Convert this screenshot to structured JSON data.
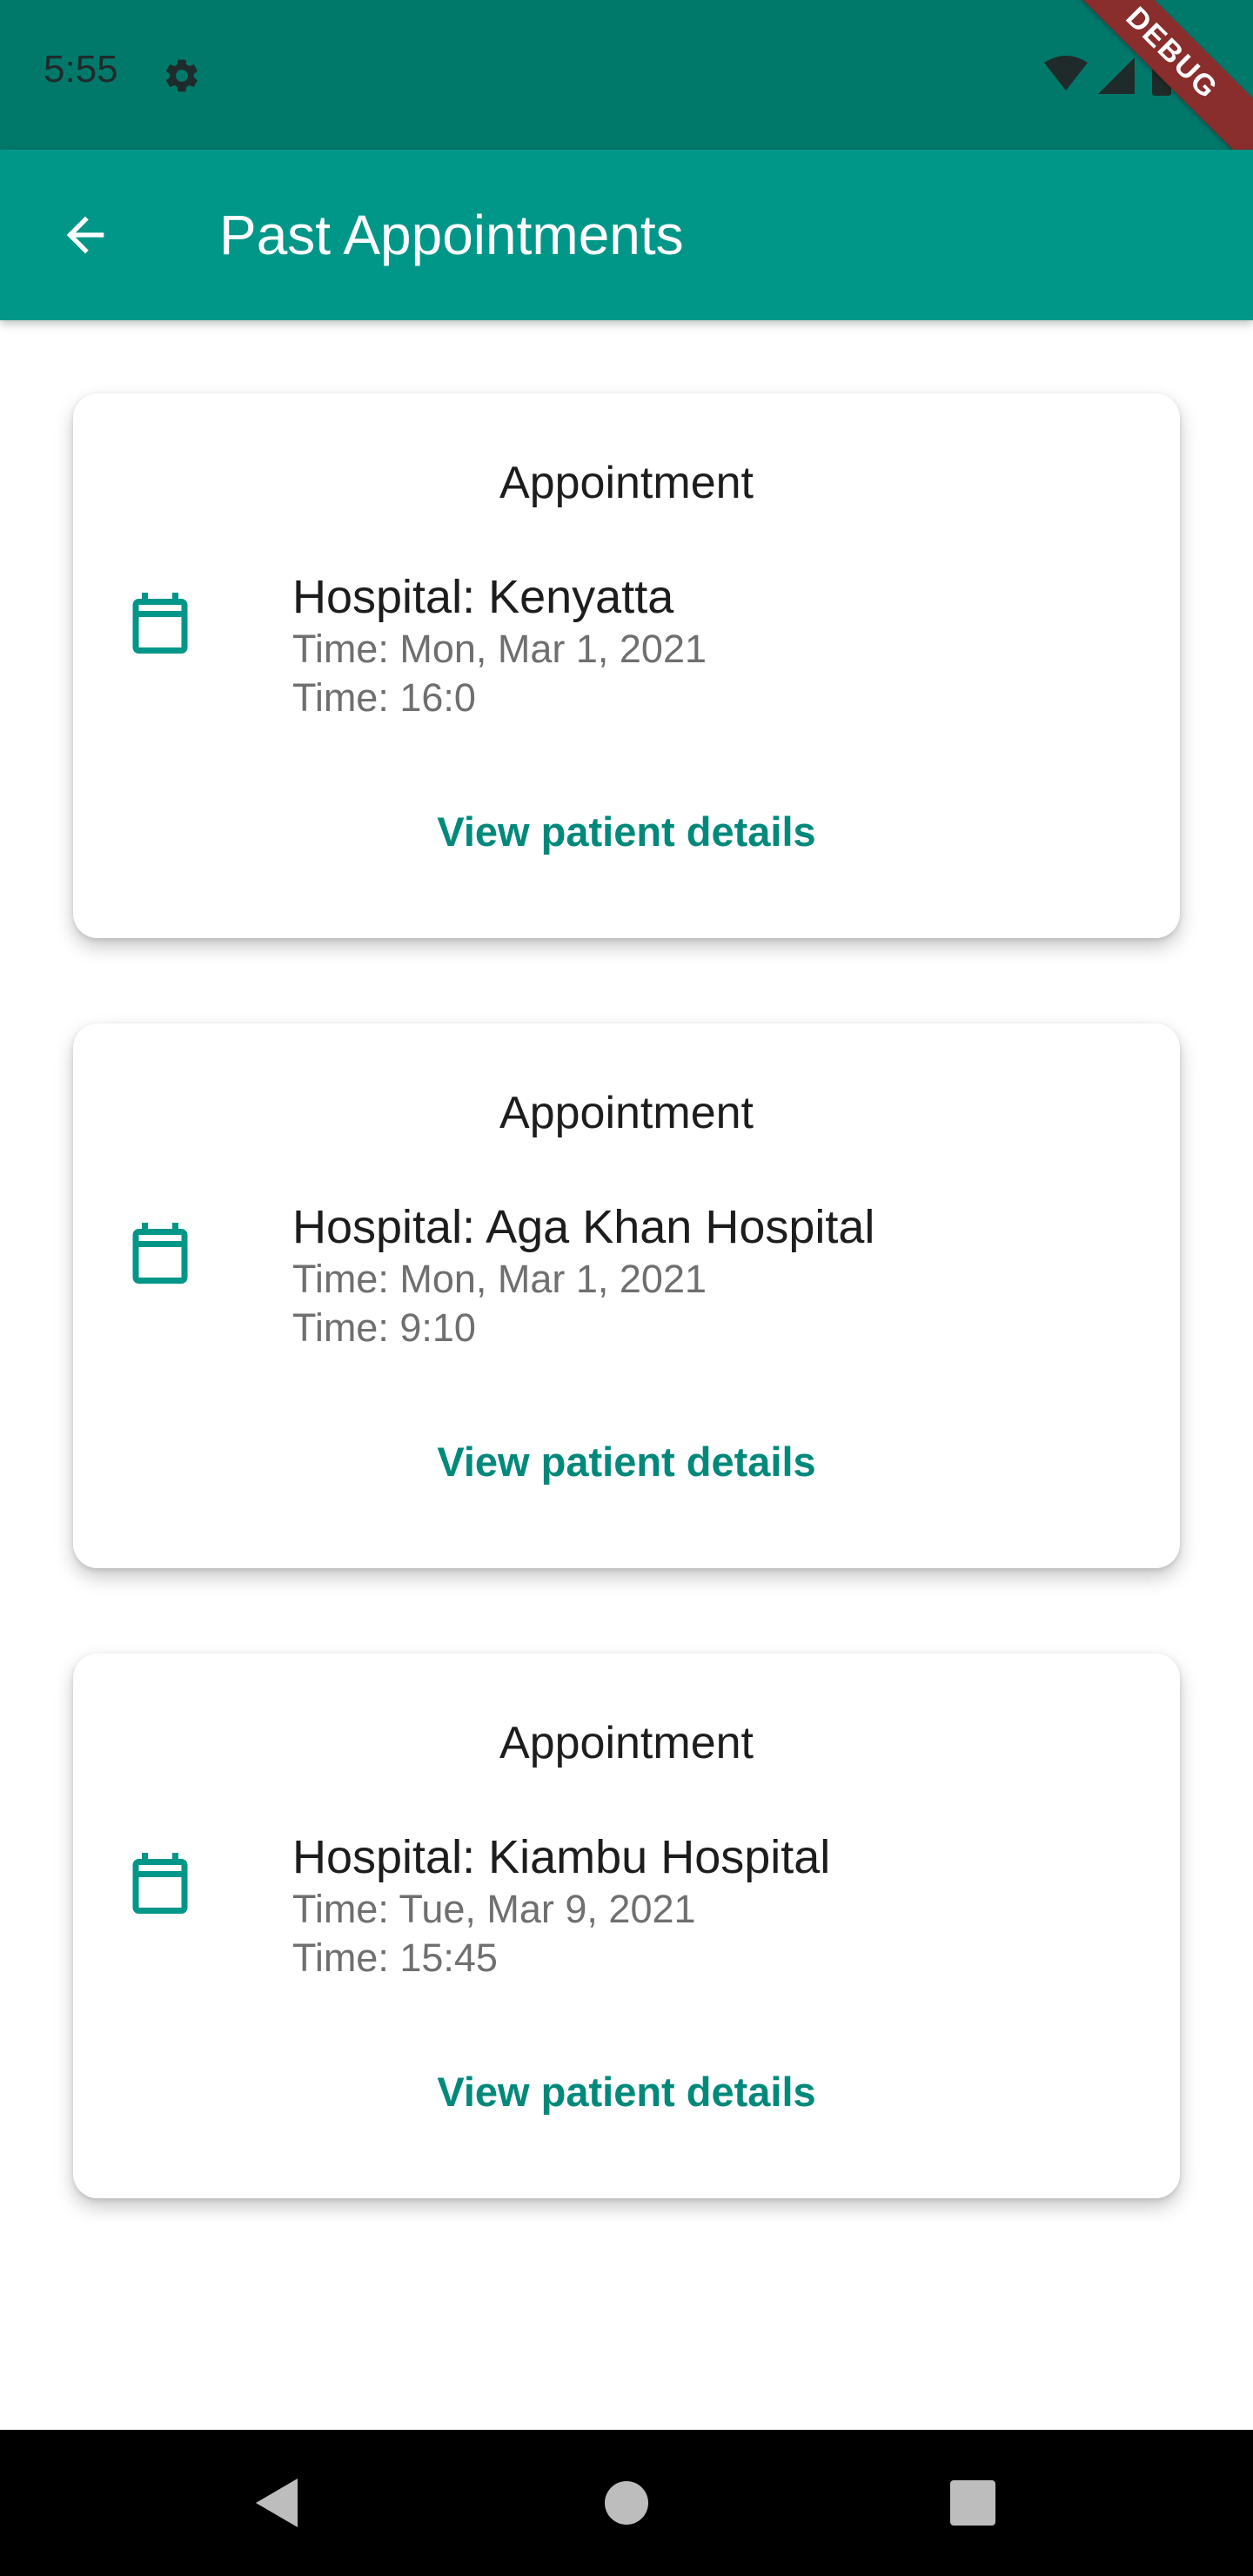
{
  "status_bar": {
    "time": "5:55",
    "debug_label": "DEBUG",
    "icons": [
      "gear-icon",
      "wifi-icon",
      "cell-signal-icon",
      "battery-icon"
    ]
  },
  "app_bar": {
    "title": "Past Appointments",
    "back_icon": "arrow-back-icon"
  },
  "colors": {
    "status_bar": "#00796b",
    "app_bar": "#009688",
    "accent": "#00897b",
    "card_background": "#ffffff",
    "nav_bar": "#000000"
  },
  "appointments": [
    {
      "title": "Appointment",
      "hospital": "Hospital: Kenyatta",
      "date": "Time: Mon, Mar 1, 2021",
      "time": "Time: 16:0",
      "action": "View patient details",
      "icon": "calendar-icon"
    },
    {
      "title": "Appointment",
      "hospital": "Hospital: Aga Khan Hospital",
      "date": "Time: Mon, Mar 1, 2021",
      "time": "Time: 9:10",
      "action": "View patient details",
      "icon": "calendar-icon"
    },
    {
      "title": "Appointment",
      "hospital": "Hospital: Kiambu Hospital",
      "date": "Time: Tue, Mar 9, 2021",
      "time": "Time: 15:45",
      "action": "View patient details",
      "icon": "calendar-icon"
    }
  ],
  "nav_bar": {
    "buttons": [
      "back-triangle-icon",
      "home-circle-icon",
      "recents-square-icon"
    ]
  }
}
